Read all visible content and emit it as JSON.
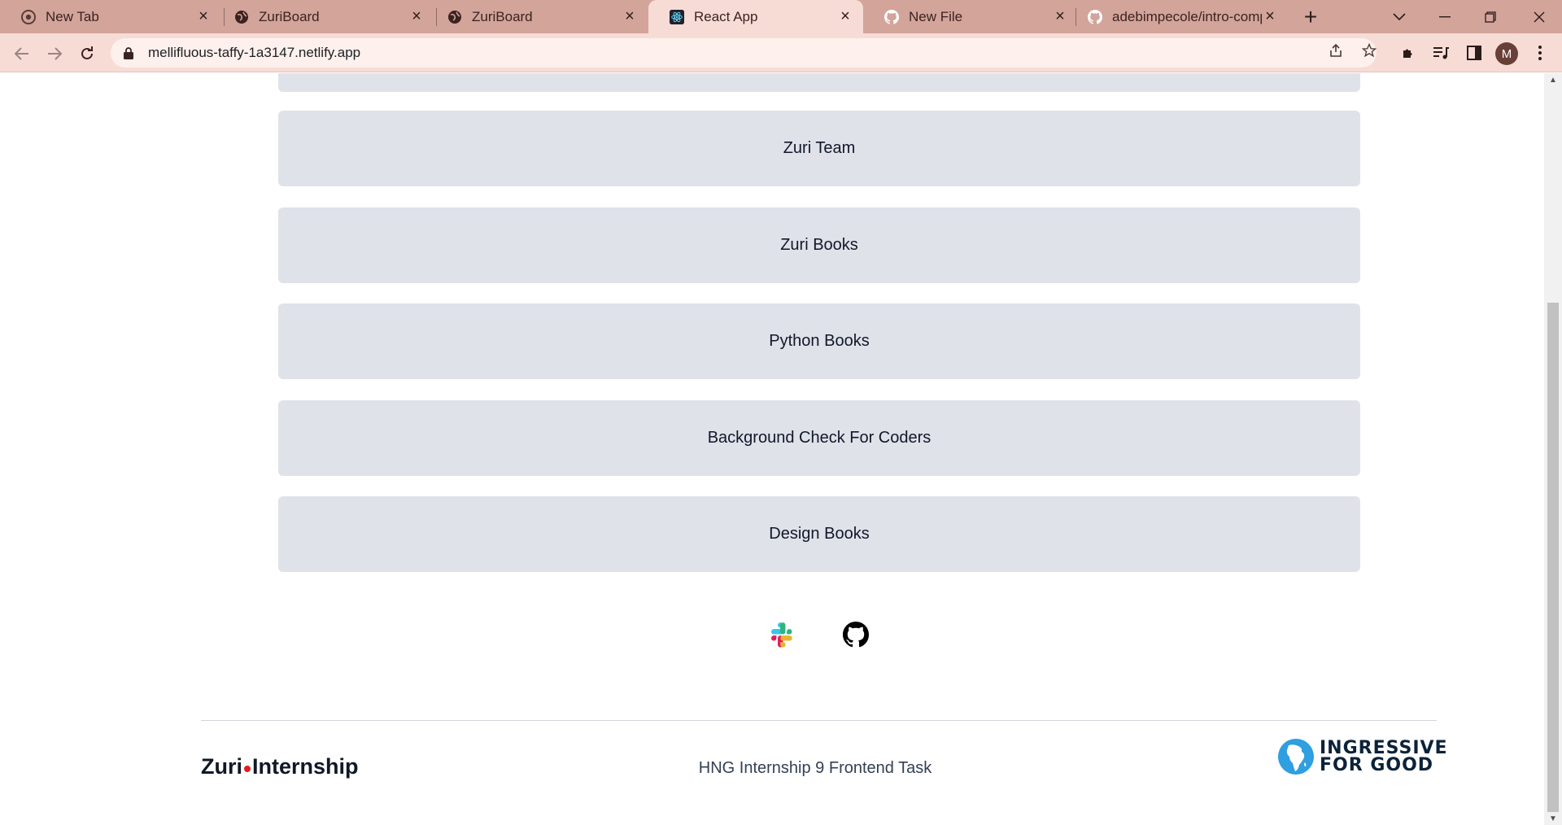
{
  "browser": {
    "tabs": [
      {
        "title": "New Tab",
        "icon": "chrome-icon"
      },
      {
        "title": "ZuriBoard",
        "icon": "globe-icon"
      },
      {
        "title": "ZuriBoard",
        "icon": "globe-icon"
      },
      {
        "title": "React App",
        "icon": "react-icon",
        "active": true
      },
      {
        "title": "New File",
        "icon": "github-icon"
      },
      {
        "title": "adebimpecole/intro-compo",
        "icon": "github-icon"
      }
    ],
    "url": "mellifluous-taffy-1a3147.netlify.app",
    "profile_initial": "M"
  },
  "page": {
    "links": [
      {
        "label": "Zuri Team"
      },
      {
        "label": "Zuri Books"
      },
      {
        "label": "Python Books"
      },
      {
        "label": "Background Check For Coders"
      },
      {
        "label": "Design Books"
      }
    ],
    "socials": [
      "slack-icon",
      "github-icon"
    ],
    "footer": {
      "brand_left": "Zuri",
      "brand_right": "Internship",
      "tagline": "HNG Internship 9 Frontend Task",
      "i4g_line1": "INGRESSIVE",
      "i4g_line2": "FOR GOOD"
    }
  },
  "colors": {
    "tabbar": "#d3a49a",
    "toolbar": "#f7dcd6",
    "card": "#e0e2ea",
    "zuri_dot": "#e31b23"
  }
}
